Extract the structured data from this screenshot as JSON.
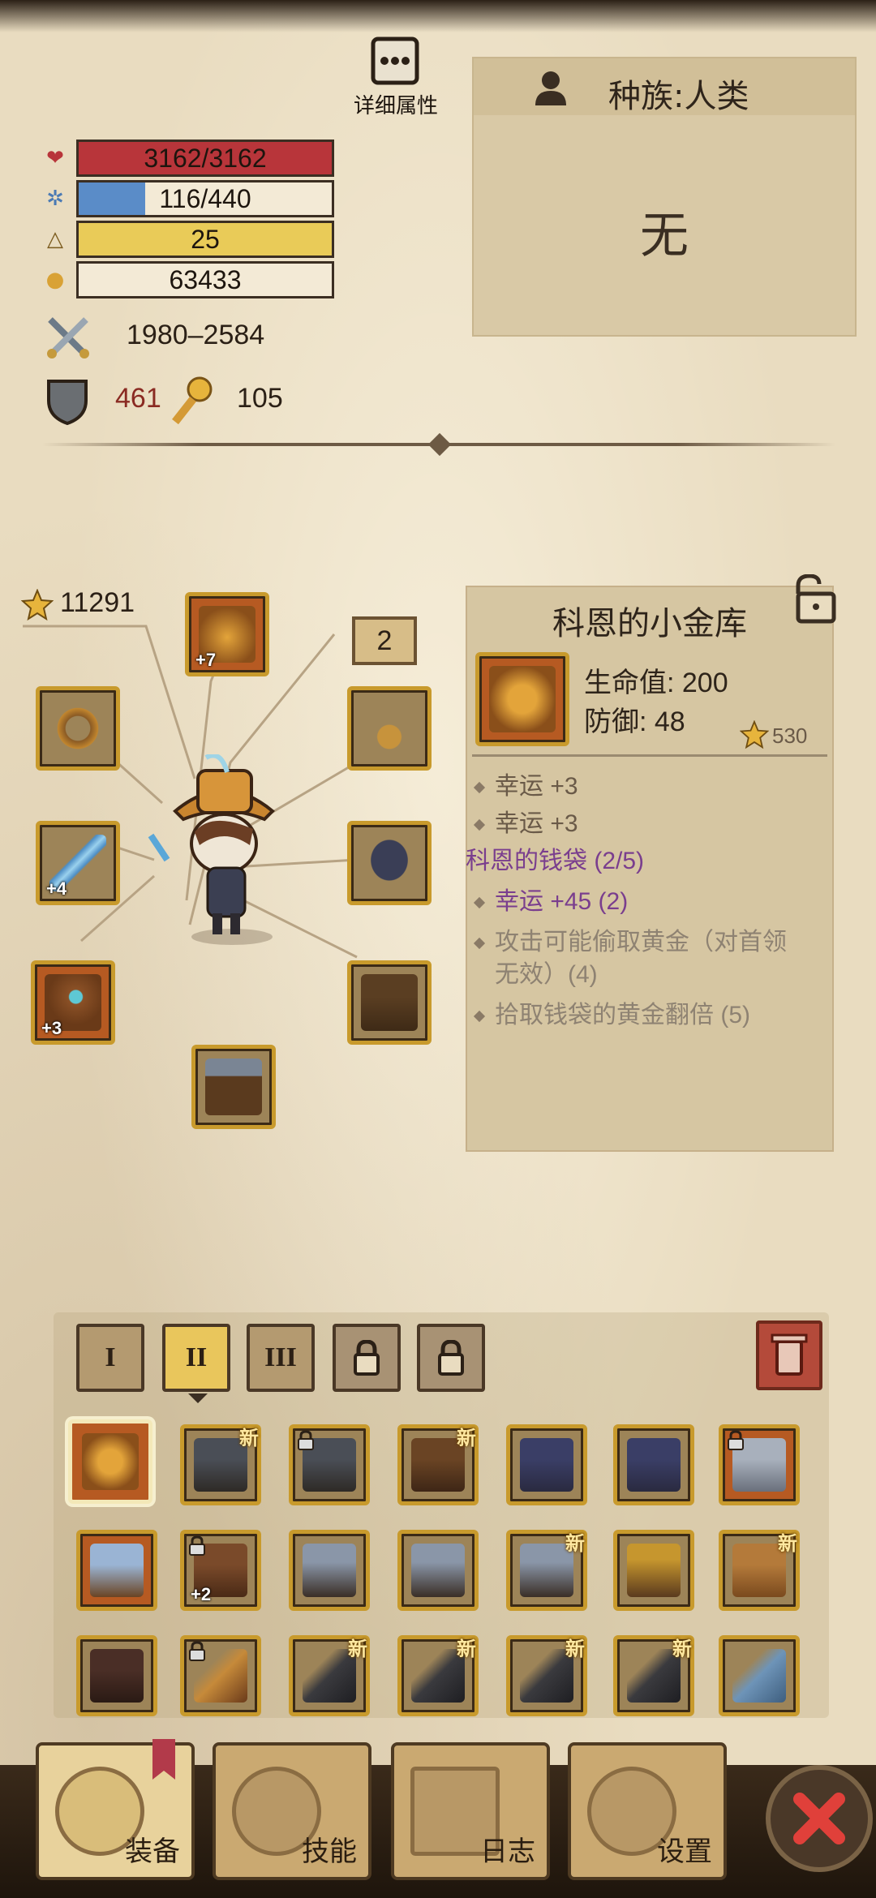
{
  "detail_button": {
    "label": "详细属性"
  },
  "stats": {
    "hp": "3162/3162",
    "mana": "116/440",
    "level": "25",
    "gold": "63433",
    "attack": "1980–2584",
    "defense": "461",
    "luck": "105"
  },
  "race": {
    "title": "种族:人类",
    "value": "无"
  },
  "equipment": {
    "rating": "11291",
    "page_badge": "2",
    "helmet_plus": "+7",
    "weapon_plus": "+4",
    "amulet_plus": "+3"
  },
  "item": {
    "name": "科恩的小金库",
    "hp_stat": "生命值: 200",
    "def_stat": "防御: 48",
    "rating": "530",
    "bonus1": "幸运 +3",
    "bonus2": "幸运 +3",
    "set_name": "科恩的钱袋 (2/5)",
    "set_bonus1": "幸运 +45 (2)",
    "set_bonus2_line1": "攻击可能偷取黄金（对首领",
    "set_bonus2_line2": "无效）(4)",
    "set_bonus3": "拾取钱袋的黄金翻倍 (5)"
  },
  "inventory": {
    "tabs": [
      "I",
      "II",
      "III"
    ],
    "new_label": "新",
    "plus2": "+2"
  },
  "nav": {
    "equip": "装备",
    "skills": "技能",
    "log": "日志",
    "settings": "设置"
  },
  "colors": {
    "hp": "#b8353a",
    "mana": "#5a8cc8",
    "level": "#e9cb58",
    "accent_purple": "#7a3e8e"
  }
}
